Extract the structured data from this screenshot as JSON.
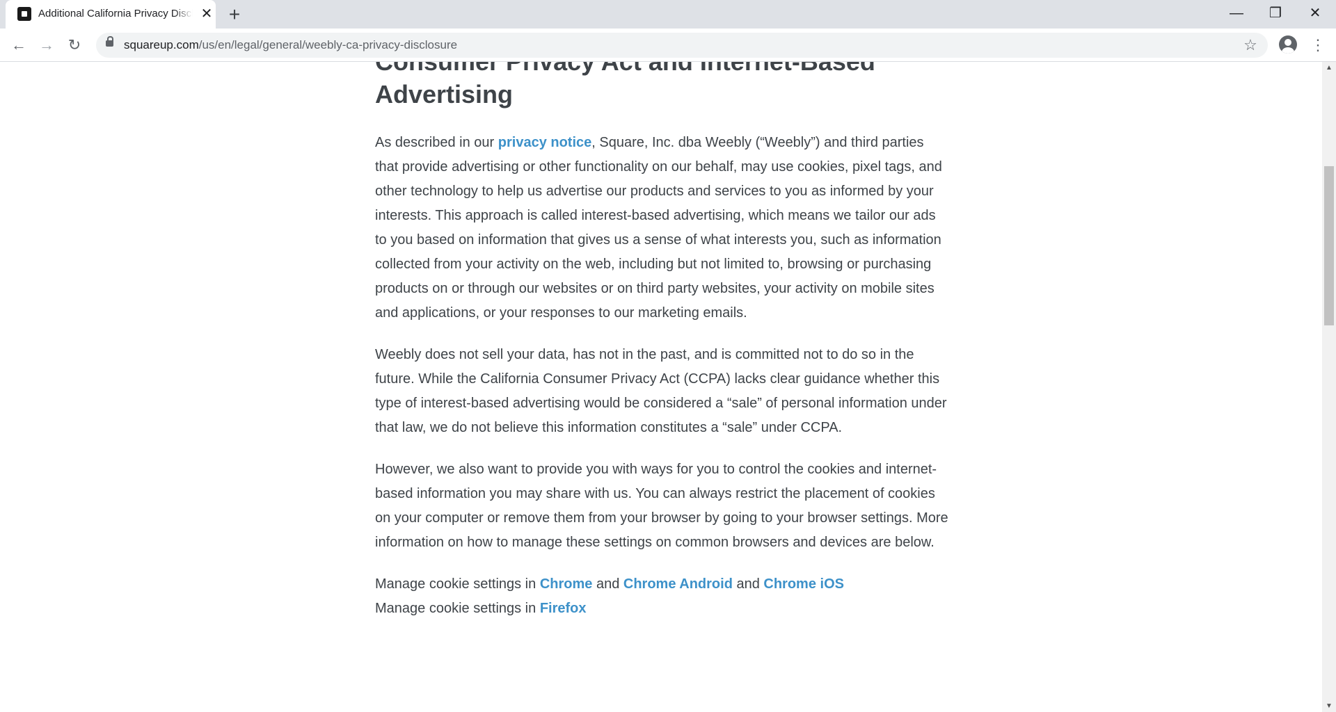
{
  "browser": {
    "tab_title": "Additional California Privacy Disclosure",
    "tab_close_glyph": "✕",
    "new_tab_glyph": "+",
    "window_controls": {
      "minimize": "—",
      "restore": "❐",
      "close": "✕"
    },
    "nav": {
      "back": "←",
      "forward": "→",
      "reload": "↻"
    },
    "url_host": "squareup.com",
    "url_path": "/us/en/legal/general/weebly-ca-privacy-disclosure",
    "star_glyph": "☆",
    "menu_glyph": "⋮",
    "scroll_up": "▲",
    "scroll_down": "▼"
  },
  "article": {
    "heading": "Consumer Privacy Act and Internet-Based Advertising",
    "p1": {
      "before": "As described in our ",
      "link": "privacy notice",
      "after": ", Square, Inc. dba Weebly (“Weebly”) and third parties that provide advertising or other functionality on our behalf, may use cookies, pixel tags, and other technology to help us advertise our products and services to you as informed by your interests. This approach is called interest-based advertising, which means we tailor our ads to you based on information that gives us a sense of what interests you, such as information collected from your activity on the web, including but not limited to, browsing or purchasing products on or through our websites or on third party websites, your activity on mobile sites and applications, or your responses to our marketing emails."
    },
    "p2": "Weebly does not sell your data, has not in the past, and is committed not to do so in the future. While the California Consumer Privacy Act (CCPA) lacks clear guidance whether this type of interest-based advertising would be considered a “sale” of personal information under that law, we do not believe this information constitutes a “sale” under CCPA.",
    "p3": "However, we also want to provide you with ways for you to control the cookies and internet-based information you may share with us. You can always restrict the placement of cookies on your computer or remove them from your browser by going to your browser settings. More information on how to manage these settings on common browsers and devices are below.",
    "cookie_line_1": {
      "prefix": "Manage cookie settings in ",
      "link_chrome": "Chrome",
      "and_1": " and ",
      "link_chrome_android": "Chrome Android",
      "and_2": " and ",
      "link_chrome_ios": "Chrome iOS"
    },
    "cookie_line_2": {
      "prefix": "Manage cookie settings in ",
      "link_firefox": "Firefox"
    }
  },
  "colors": {
    "link": "#3d91c9",
    "text": "#3e4348",
    "tabstrip": "#dee1e6",
    "omnibox": "#f1f3f4"
  }
}
